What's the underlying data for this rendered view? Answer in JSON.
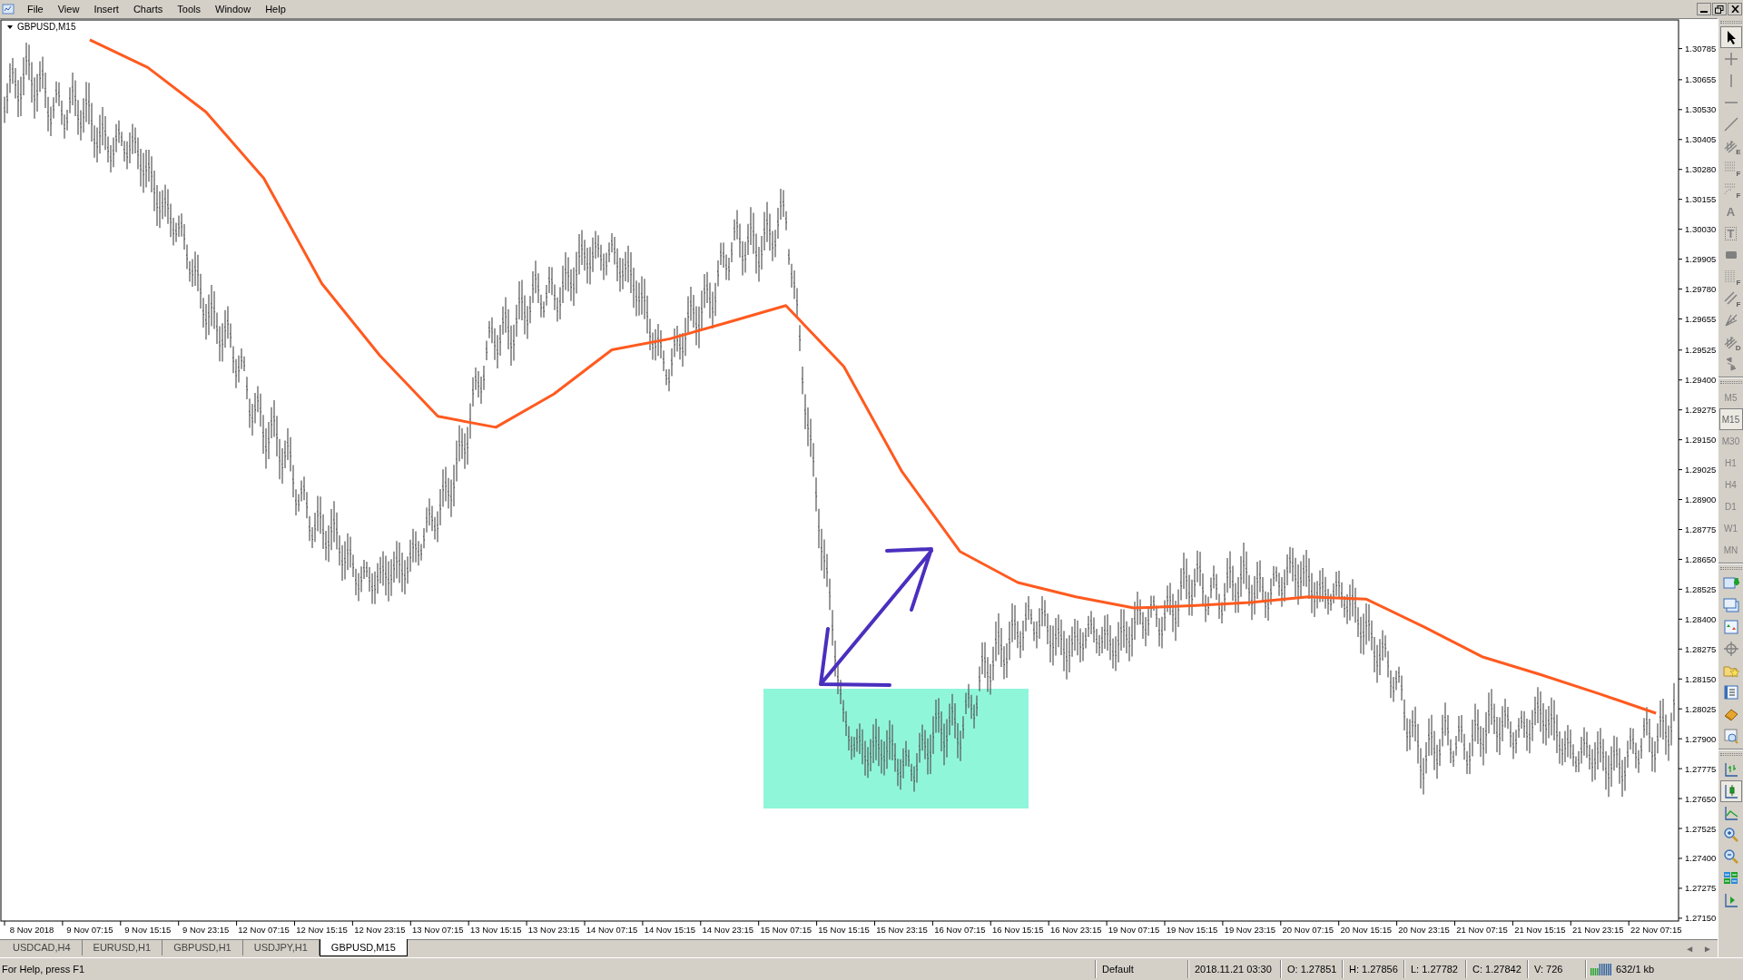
{
  "menu": [
    "File",
    "View",
    "Insert",
    "Charts",
    "Tools",
    "Window",
    "Help"
  ],
  "chart": {
    "symbol_label": "GBPUSD,M15",
    "objects": [
      {
        "kind": "rectangle",
        "color": "#90f6da"
      },
      {
        "kind": "arrow",
        "color": "#4a2fbf"
      }
    ],
    "chart_data": {
      "type": "line",
      "ylim": [
        1.27142,
        1.30901
      ],
      "series": [
        {
          "color": "#ff5a1f",
          "values": [
            null,
            1.30822,
            1.30706,
            1.30521,
            1.30243,
            1.29803,
            1.29502,
            1.29248,
            1.29202,
            1.29341,
            1.29526,
            1.29572,
            1.29641,
            1.29711,
            1.29456,
            1.29017,
            1.28683,
            1.28553,
            1.28493,
            1.28447,
            1.28456,
            1.2847,
            1.28493,
            1.28484,
            1.28368,
            1.28243,
            1.28169,
            1.2809,
            1.28007
          ]
        }
      ],
      "yticks": [
        {
          "value": 1.30785,
          "label": "1.30785"
        },
        {
          "value": 1.30655,
          "label": "1.30655"
        },
        {
          "value": 1.3053,
          "label": "1.30530"
        },
        {
          "value": 1.30405,
          "label": "1.30405"
        },
        {
          "value": 1.3028,
          "label": "1.30280"
        },
        {
          "value": 1.30155,
          "label": "1.30155"
        },
        {
          "value": 1.3003,
          "label": "1.30030"
        },
        {
          "value": 1.29905,
          "label": "1.29905"
        },
        {
          "value": 1.2978,
          "label": "1.29780"
        },
        {
          "value": 1.29655,
          "label": "1.29655"
        },
        {
          "value": 1.29525,
          "label": "1.29525"
        },
        {
          "value": 1.294,
          "label": "1.29400"
        },
        {
          "value": 1.29275,
          "label": "1.29275"
        },
        {
          "value": 1.2915,
          "label": "1.29150"
        },
        {
          "value": 1.29025,
          "label": "1.29025"
        },
        {
          "value": 1.289,
          "label": "1.28900"
        },
        {
          "value": 1.28775,
          "label": "1.28775"
        },
        {
          "value": 1.2865,
          "label": "1.28650"
        },
        {
          "value": 1.28525,
          "label": "1.28525"
        },
        {
          "value": 1.284,
          "label": "1.28400"
        },
        {
          "value": 1.28275,
          "label": "1.28275"
        },
        {
          "value": 1.2815,
          "label": "1.28150"
        },
        {
          "value": 1.28025,
          "label": "1.28025"
        },
        {
          "value": 1.279,
          "label": "1.27900"
        },
        {
          "value": 1.27775,
          "label": "1.27775"
        },
        {
          "value": 1.2765,
          "label": "1.27650"
        },
        {
          "value": 1.27525,
          "label": "1.27525"
        },
        {
          "value": 1.274,
          "label": "1.27400"
        },
        {
          "value": 1.27275,
          "label": "1.27275"
        },
        {
          "value": 1.2715,
          "label": "1.27150"
        }
      ],
      "categories": [
        "8 Nov 2018",
        "9 Nov 07:15",
        "9 Nov 15:15",
        "9 Nov 23:15",
        "12 Nov 07:15",
        "12 Nov 15:15",
        "12 Nov 23:15",
        "13 Nov 07:15",
        "13 Nov 15:15",
        "13 Nov 23:15",
        "14 Nov 07:15",
        "14 Nov 15:15",
        "14 Nov 23:15",
        "15 Nov 07:15",
        "15 Nov 15:15",
        "15 Nov 23:15",
        "16 Nov 07:15",
        "16 Nov 15:15",
        "16 Nov 23:15",
        "19 Nov 07:15",
        "19 Nov 15:15",
        "19 Nov 23:15",
        "20 Nov 07:15",
        "20 Nov 15:15",
        "20 Nov 23:15",
        "21 Nov 07:15",
        "21 Nov 15:15",
        "21 Nov 23:15",
        "22 Nov 07:15"
      ]
    }
  },
  "tab_scroll": {
    "left": "◄",
    "right": "►"
  },
  "tabs": [
    {
      "label": "USDCAD,H4",
      "selected": false
    },
    {
      "label": "EURUSD,H1",
      "selected": false
    },
    {
      "label": "GBPUSD,H1",
      "selected": false
    },
    {
      "label": "USDJPY,H1",
      "selected": false
    },
    {
      "label": "GBPUSD,M15",
      "selected": true
    }
  ],
  "toolbar": {
    "tools": [
      {
        "kind": "cursor",
        "selected": true
      },
      {
        "kind": "crosshair",
        "selected": false
      },
      {
        "kind": "vline",
        "selected": false
      },
      {
        "kind": "hline",
        "selected": false
      },
      {
        "kind": "trend",
        "selected": false
      },
      {
        "kind": "pitchfork",
        "sub": "E",
        "selected": false
      },
      {
        "kind": "fibo",
        "sub": "F",
        "selected": false
      },
      {
        "kind": "fibofan",
        "sub": "F",
        "selected": false
      },
      {
        "kind": "glyph",
        "glyph": "A",
        "selected": false
      },
      {
        "kind": "glyphbox",
        "glyph": "T",
        "selected": false
      },
      {
        "kind": "rect",
        "selected": false
      },
      {
        "kind": "fibotime",
        "sub": "F",
        "selected": false
      },
      {
        "kind": "channel",
        "sub": "F",
        "selected": false
      },
      {
        "kind": "gann",
        "selected": false
      },
      {
        "kind": "pitchfork",
        "sub": "D",
        "selected": false
      },
      {
        "kind": "arrows",
        "selected": false
      }
    ],
    "timeframes": [
      {
        "label": "M5",
        "selected": false
      },
      {
        "label": "M15",
        "selected": true
      },
      {
        "label": "M30",
        "selected": false
      },
      {
        "label": "H1",
        "selected": false
      },
      {
        "label": "H4",
        "selected": false
      },
      {
        "label": "D1",
        "selected": false
      },
      {
        "label": "W1",
        "selected": false
      },
      {
        "label": "MN",
        "selected": false
      }
    ],
    "standard": [
      {
        "kind": "newchart"
      },
      {
        "kind": "profiles"
      },
      {
        "kind": "market"
      },
      {
        "kind": "target"
      },
      {
        "kind": "folderstar"
      },
      {
        "kind": "datawin"
      },
      {
        "kind": "tester"
      },
      {
        "kind": "clock"
      }
    ],
    "charting": [
      {
        "kind": "bars",
        "selected": false
      },
      {
        "kind": "candles",
        "selected": true
      },
      {
        "kind": "linechart",
        "selected": false
      },
      {
        "kind": "zoomin",
        "selected": false
      },
      {
        "kind": "zoomout",
        "selected": false
      },
      {
        "kind": "tile",
        "selected": false
      },
      {
        "kind": "autoscroll",
        "selected": false
      }
    ]
  },
  "status_bar": {
    "help": "For Help, press F1",
    "profile": "Default",
    "time": "2018.11.21 03:30",
    "open": "O: 1.27851",
    "high": "H: 1.27856",
    "low": "L: 1.27782",
    "close": "C: 1.27842",
    "volume": "V: 726",
    "traffic": "632/1 kb"
  }
}
